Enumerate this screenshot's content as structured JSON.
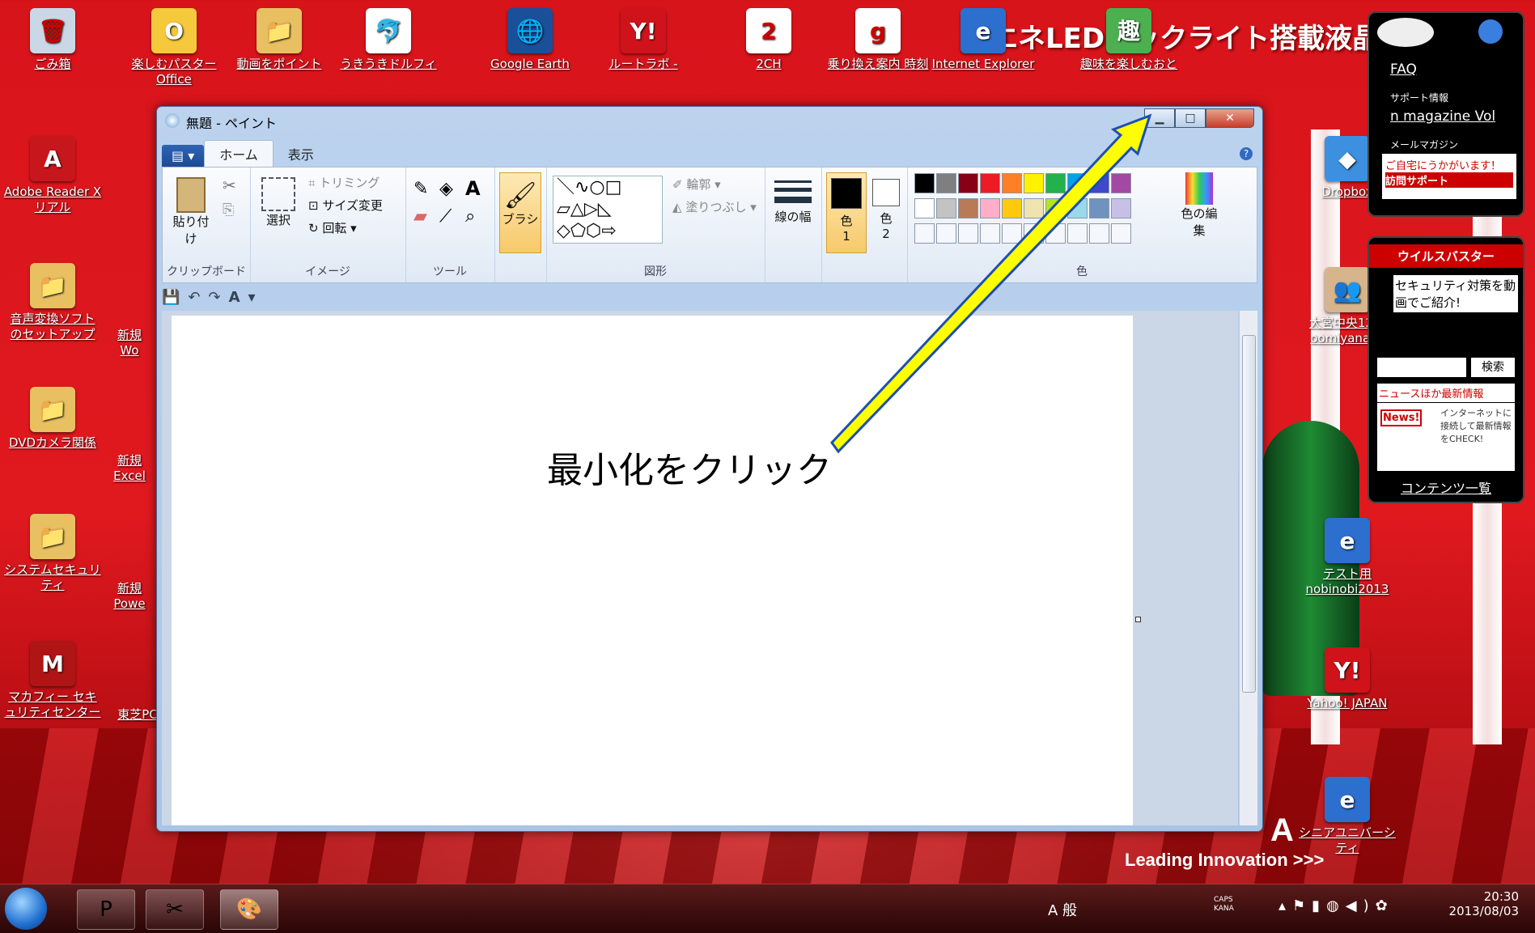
{
  "desktop": {
    "banner": "省エネLEDバックライト搭載液晶",
    "brand": "Leading Innovation >>>",
    "brand_big": "A",
    "icons": [
      {
        "label": "ごみ箱",
        "label2": "",
        "glyph": "🗑",
        "color": "#c9d7e6"
      },
      {
        "label": "楽しむパスター",
        "label2": "Office",
        "glyph": "O",
        "color": "#f6c83c"
      },
      {
        "label": "動画をポイント",
        "label2": "",
        "glyph": "📁",
        "color": "#e8c062"
      },
      {
        "label": "うきうきドルフィ",
        "label2": "",
        "glyph": "🐬",
        "color": "#ffffff"
      },
      {
        "label": "Google Earth",
        "label2": "",
        "glyph": "🌐",
        "color": "#1a4f9a"
      },
      {
        "label": "ルートラボ -",
        "label2": "",
        "glyph": "Y!",
        "color": "#d0121a"
      },
      {
        "label": "2CH",
        "label2": "",
        "glyph": "2",
        "color": "#ffffff"
      },
      {
        "label": "乗り換え案内 時刻",
        "label2": "",
        "glyph": "g",
        "color": "#ffffff"
      },
      {
        "label": "Internet Explorer",
        "label2": "",
        "glyph": "e",
        "color": "#2d6fcf"
      },
      {
        "label": "趣味を楽しむおと",
        "label2": "",
        "glyph": "趣",
        "color": "#4caf50"
      },
      {
        "label": "Adobe Reader X",
        "label2": "リアル",
        "glyph": "A",
        "color": "#c8161d"
      },
      {
        "label": "音声変換ソフト",
        "label2": "のセットアップ",
        "glyph": "📁",
        "color": "#e8c062"
      },
      {
        "label": "DVDカメラ関係",
        "label2": "",
        "glyph": "📁",
        "color": "#e8c062"
      },
      {
        "label": "システムセキュリ",
        "label2": "ティ",
        "glyph": "📁",
        "color": "#e8c062"
      },
      {
        "label": "マカフィー セキ",
        "label2": "ュリティセンター",
        "glyph": "M",
        "color": "#b01515"
      },
      {
        "label": "Dropbox",
        "label2": "",
        "glyph": "◆",
        "color": "#3d8fe0"
      },
      {
        "label": "大宮中央12期",
        "label2": "oomiyanaka",
        "glyph": "👥",
        "color": "#d6b48c"
      },
      {
        "label": "テスト用",
        "label2": "nobinobi2013",
        "glyph": "e",
        "color": "#2d6fcf"
      },
      {
        "label": "Yahoo! JAPAN",
        "label2": "",
        "glyph": "Y!",
        "color": "#d0121a"
      },
      {
        "label": "シニアユニバーシ",
        "label2": "ティ",
        "glyph": "e",
        "color": "#2d6fcf"
      }
    ],
    "partial_labels": [
      "新規",
      "Wo",
      "新規",
      "Excel",
      "新規",
      "Powe",
      "東芝PC"
    ]
  },
  "paint": {
    "title": "無題 - ペイント",
    "tabs": [
      "ホーム",
      "表示"
    ],
    "menu_glyph": "▤ ▾",
    "groups": {
      "clipboard": {
        "label": "クリップボード",
        "paste": "貼り付け"
      },
      "image": {
        "label": "イメージ",
        "select": "選択",
        "crop": "トリミング",
        "resize": "サイズ変更",
        "rotate": "回転 ▾"
      },
      "tools": {
        "label": "ツール"
      },
      "brush": {
        "label": "ブラシ"
      },
      "shapes": {
        "label": "図形",
        "outline": "輪郭 ▾",
        "fill": "塗りつぶし ▾"
      },
      "size": {
        "label": "線の幅"
      },
      "color1": {
        "label": "色",
        "num": "1"
      },
      "color2": {
        "label": "色",
        "num": "2"
      },
      "colors": {
        "label": "色",
        "edit": "色の編集"
      }
    },
    "palette_row1": [
      "#000000",
      "#7f7f7f",
      "#880015",
      "#ed1c24",
      "#ff7f27",
      "#fff200",
      "#22b14c",
      "#00a2e8",
      "#3f48cc",
      "#a349a4"
    ],
    "palette_row2": [
      "#ffffff",
      "#c3c3c3",
      "#b97a57",
      "#ffaec9",
      "#ffc90e",
      "#efe4b0",
      "#b5e61d",
      "#99d9ea",
      "#7092be",
      "#c8bfe7"
    ]
  },
  "annotation": {
    "text": "最小化をクリック",
    "arrow_color": "#ffff00"
  },
  "gadgets": {
    "faq": "FAQ",
    "support": "サポート情報",
    "magazine": "n magazine Vol",
    "mail": "メールマガジン",
    "home": "ご自宅にうかがいます！",
    "visit": "訪問サポート",
    "virus": "ウイルスバスター",
    "security": "セキュリティ対策を動画でご紹介!",
    "search": "検索",
    "news_title": "ニュースほか最新情報",
    "news_badge": "News!",
    "news_text": "インターネットに接続して最新情報をCHECK!",
    "contents": "コンテンツ一覧"
  },
  "taskbar": {
    "time": "20:30",
    "date": "2013/08/03",
    "ime": "A 般",
    "caps": "CAPS KANA"
  }
}
